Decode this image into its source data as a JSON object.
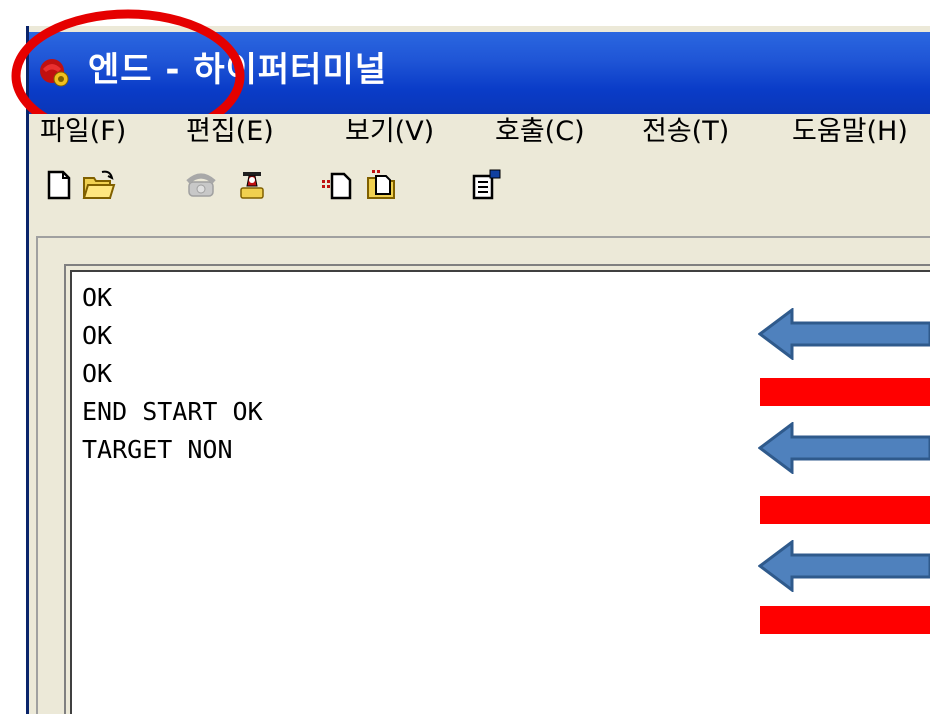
{
  "window": {
    "title": "엔드 - 하이퍼터미널"
  },
  "menubar": {
    "items": [
      {
        "label": "파일(F)"
      },
      {
        "label": "편집(E)"
      },
      {
        "label": "보기(V)"
      },
      {
        "label": "호출(C)"
      },
      {
        "label": "전송(T)"
      },
      {
        "label": "도움말(H)"
      }
    ]
  },
  "toolbar": {
    "icons": [
      "new-document-icon",
      "open-folder-icon",
      "call-phone-icon",
      "disconnect-phone-icon",
      "send-file-icon",
      "receive-file-icon",
      "properties-icon"
    ]
  },
  "terminal": {
    "lines": [
      "OK",
      "OK",
      "OK",
      "END START OK",
      "TARGET NON"
    ]
  },
  "annotations": {
    "highlight_color": "#e50000",
    "arrow_color": "#4f81bd",
    "bar_color": "#ff0000"
  }
}
